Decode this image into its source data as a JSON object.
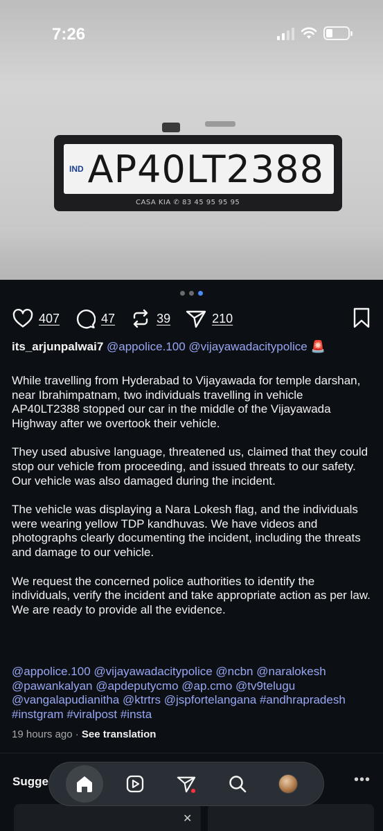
{
  "status_bar": {
    "time": "7:26"
  },
  "photo": {
    "plate_country": "IND",
    "plate_number": "AP40LT2388",
    "dealer_text": "CASA KIA ✆ 83 45 95 95 95"
  },
  "carousel": {
    "count": 3,
    "active_index": 2
  },
  "actions": {
    "likes": "407",
    "comments": "47",
    "reposts": "39",
    "shares": "210"
  },
  "post": {
    "username": "its_arjunpalwai7",
    "mentions": [
      "@appolice.100",
      "@vijayawadacitypolice"
    ],
    "siren_emoji": "🚨",
    "paragraphs": [
      "While travelling from Hyderabad to Vijayawada for temple darshan, near Ibrahimpatnam, two individuals travelling in vehicle AP40LT2388 stopped our car in the middle of the Vijayawada Highway after we overtook their vehicle.",
      "They used abusive language, threatened us, claimed that they could stop our vehicle from proceeding, and issued threats to our safety. Our vehicle was also damaged during the incident.",
      "The vehicle was displaying a Nara Lokesh flag, and the individuals were wearing yellow TDP kandhuvas. We have videos and photographs clearly documenting the incident, including the threats and damage to our vehicle.",
      "We request the concerned police authorities to identify the individuals, verify the incident and take appropriate action as per law. We are ready to provide all the evidence."
    ],
    "tags": "@appolice.100 @vijayawadacitypolice @ncbn @naralokesh @pawankalyan @apdeputycmo @ap.cmo @tv9telugu @vangalapudianitha @ktrtrs @jspfortelangana #andhrapradesh #instgram #viralpost #insta",
    "time_ago": "19 hours ago",
    "separator": "·",
    "translate_label": "See translation"
  },
  "suggested_label": "Sugge",
  "more_label": "•••",
  "close_label": "✕",
  "nav": {
    "items": [
      "home-icon",
      "reels-icon",
      "send-icon",
      "search-icon",
      "profile-avatar"
    ],
    "active": "home"
  },
  "colors": {
    "background": "#0c1014",
    "mention": "#98a6f3",
    "carousel_active": "#4a8cf7",
    "notification": "#ff3040"
  }
}
